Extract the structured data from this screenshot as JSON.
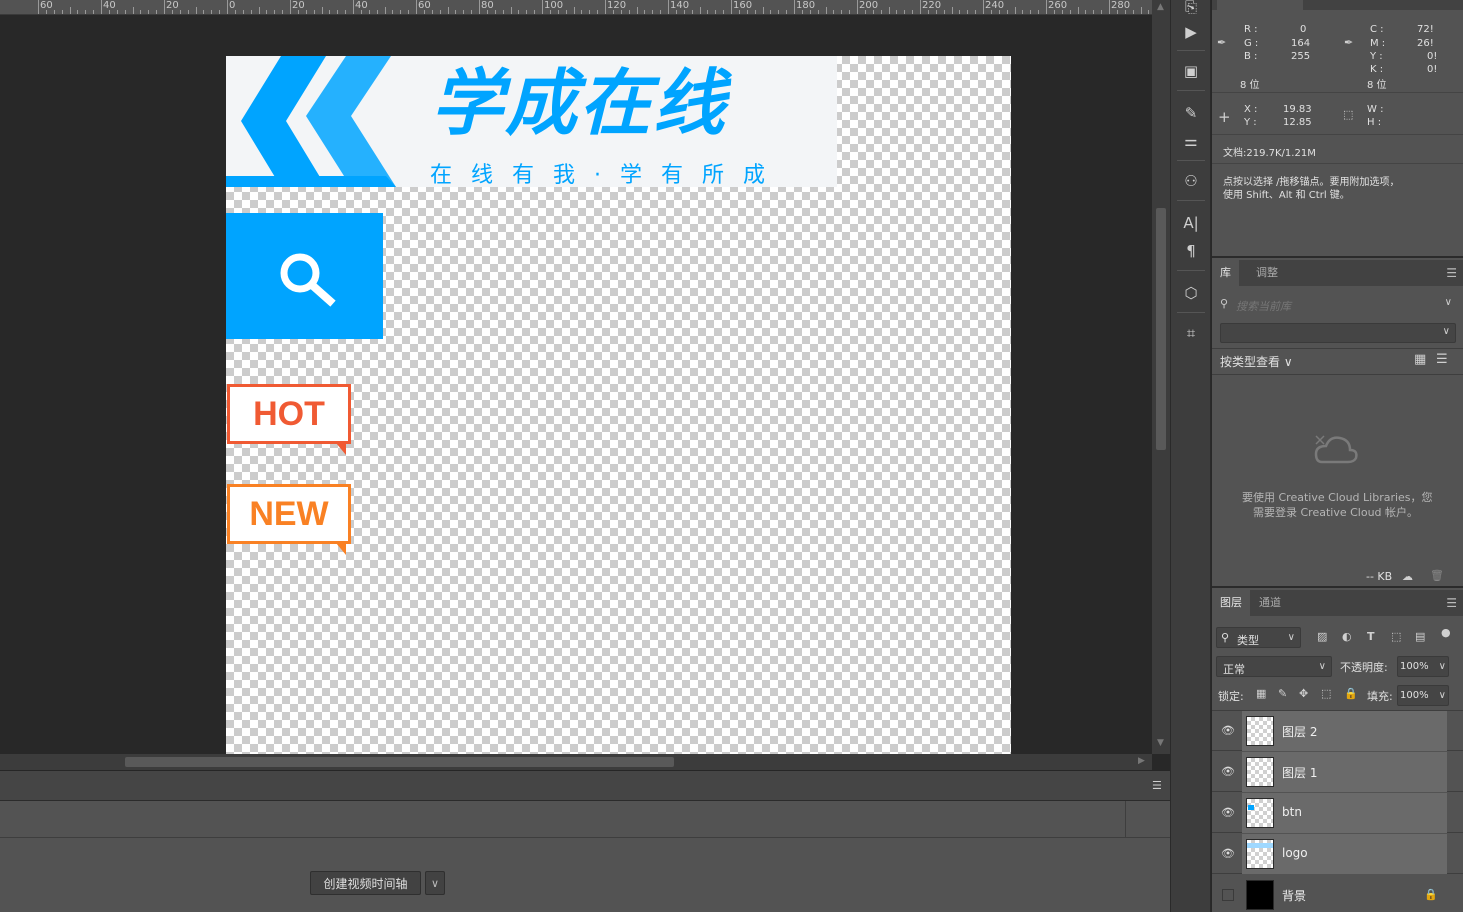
{
  "ruler": {
    "labels": [
      "60",
      "40",
      "20",
      "0",
      "20",
      "40",
      "60",
      "80",
      "100",
      "120",
      "140",
      "160",
      "180",
      "200",
      "220",
      "240",
      "260",
      "280"
    ]
  },
  "canvas": {
    "logo_title": "学成在线",
    "logo_subtitle": "在线有我·学有所成",
    "hot_label": "HOT",
    "new_label": "NEW",
    "colors": {
      "brand_blue": "#00a4ff",
      "hot_red": "#f05a33",
      "new_orange": "#f98124"
    }
  },
  "timeline": {
    "create_button": "创建视频时间轴",
    "dropdown_icon": "chevron-down-icon"
  },
  "info": {
    "r_label": "R :",
    "g_label": "G :",
    "b_label": "B :",
    "r_value": "0",
    "g_value": "164",
    "b_value": "255",
    "c_label": "C :",
    "m_label": "M :",
    "y_label": "Y :",
    "k_label": "K :",
    "c_value": "72!",
    "m_value": "26!",
    "y_value": "0!",
    "k_value": "0!",
    "bits_left": "8 位",
    "bits_right": "8 位",
    "x_label": "X :",
    "y2_label": "Y :",
    "x_value": "19.83",
    "y_value2": "12.85",
    "w_label": "W :",
    "h_label": "H :",
    "doc_size": "文档:219.7K/1.21M",
    "hint_line1": "点按以选择 /拖移锚点。要用附加选项，",
    "hint_line2": "使用 Shift、Alt 和 Ctrl 键。"
  },
  "libraries": {
    "tab_library": "库",
    "tab_adjust": "调整",
    "search_placeholder": "搜索当前库",
    "view_by": "按类型查看",
    "cc_message_1": "要使用 Creative Cloud Libraries，您",
    "cc_message_2": "需要登录 Creative Cloud 帐户。",
    "size": "-- KB"
  },
  "layers": {
    "tab_layers": "图层",
    "tab_channels": "通道",
    "filter_kind": "类型",
    "blend_mode": "正常",
    "opacity_label": "不透明度:",
    "opacity_value": "100%",
    "lock_label": "锁定:",
    "fill_label": "填充:",
    "fill_value": "100%",
    "items": [
      {
        "name": "图层 2"
      },
      {
        "name": "图层 1"
      },
      {
        "name": "btn"
      },
      {
        "name": "logo"
      },
      {
        "name": "背景"
      }
    ]
  }
}
